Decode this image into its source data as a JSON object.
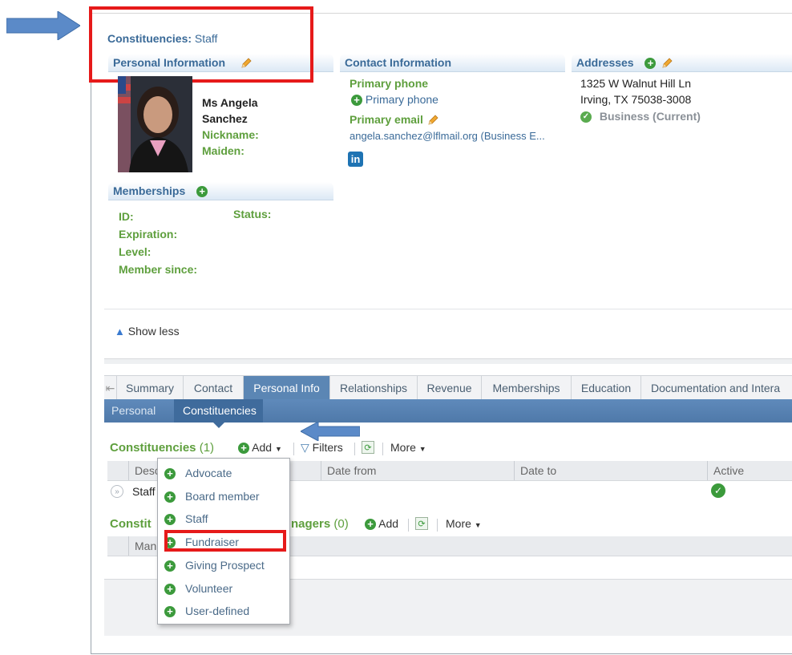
{
  "header": {
    "constituencies_label": "Constituencies:",
    "constituencies_value": "Staff"
  },
  "personal_info": {
    "title": "Personal Information",
    "name_line1": "Ms Angela",
    "name_line2": "Sanchez",
    "nickname_label": "Nickname:",
    "maiden_label": "Maiden:"
  },
  "contact_info": {
    "title": "Contact Information",
    "primary_phone_label": "Primary phone",
    "primary_phone_add": "Primary phone",
    "primary_email_label": "Primary email",
    "primary_email_value": "angela.sanchez@lflmail.org (Business E...",
    "linkedin_label": "in"
  },
  "addresses": {
    "title": "Addresses",
    "line1": "1325 W Walnut Hill Ln",
    "line2": "Irving, TX 75038-3008",
    "type": "Business (Current)"
  },
  "memberships": {
    "title": "Memberships",
    "id_label": "ID:",
    "status_label": "Status:",
    "expiration_label": "Expiration:",
    "level_label": "Level:",
    "member_since_label": "Member since:"
  },
  "show_less": "Show less",
  "tabs": [
    "Summary",
    "Contact",
    "Personal Info",
    "Relationships",
    "Revenue",
    "Memberships",
    "Education",
    "Documentation and Intera"
  ],
  "subtabs": [
    "Personal",
    "Constituencies"
  ],
  "constituencies_section": {
    "title": "Constituencies",
    "count": "(1)",
    "add": "Add",
    "filters": "Filters",
    "more": "More",
    "columns": [
      "Desc",
      "Date from",
      "Date to",
      "Active"
    ],
    "row_value": "Staff"
  },
  "managers_section": {
    "title_start": "Constit",
    "title_end": "nagers",
    "count": "(0)",
    "add": "Add",
    "more": "More",
    "column": "Man"
  },
  "add_menu": [
    "Advocate",
    "Board member",
    "Staff",
    "Fundraiser",
    "Giving Prospect",
    "Volunteer",
    "User-defined"
  ],
  "colors": {
    "accent_blue": "#3a6a98",
    "label_green": "#5e9f3d",
    "tab_active": "#5b86b4",
    "highlight_red": "#e61a1a",
    "callout_arrow": "#5b8ac8"
  }
}
